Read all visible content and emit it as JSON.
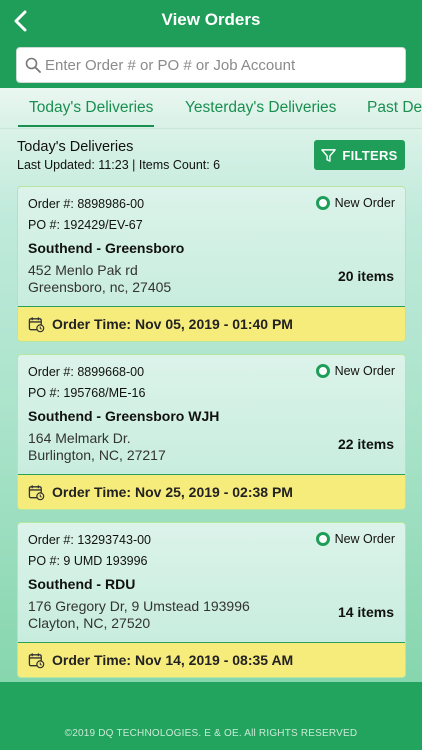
{
  "header": {
    "title": "View Orders",
    "back_icon": "back-arrow-icon"
  },
  "search": {
    "placeholder": "Enter Order # or PO # or Job Account",
    "value": ""
  },
  "tabs": [
    {
      "label": "Today's Deliveries",
      "active": true
    },
    {
      "label": "Yesterday's Deliveries",
      "active": false
    },
    {
      "label": "Past Deliveries",
      "active": false
    }
  ],
  "list": {
    "title": "Today's Deliveries",
    "meta": "Last Updated: 11:23 | Items Count: 6",
    "filters_label": "FILTERS"
  },
  "orders": [
    {
      "order": "Order #: 8898986-00",
      "po": "PO #: 192429/EV-67",
      "name": "Southend - Greensboro",
      "addr1": "452 Menlo Pak rd",
      "addr2": "Greensboro, nc, 27405",
      "items": "20 items",
      "status": "New Order",
      "order_time": "Order Time: Nov 05, 2019 - 01:40 PM"
    },
    {
      "order": "Order #: 8899668-00",
      "po": "PO #: 195768/ME-16",
      "name": "Southend - Greensboro WJH",
      "addr1": "164 Melmark Dr.",
      "addr2": "Burlington, NC, 27217",
      "items": "22 items",
      "status": "New Order",
      "order_time": "Order Time: Nov 25, 2019 - 02:38 PM"
    },
    {
      "order": "Order #: 13293743-00",
      "po": "PO #: 9 UMD 193996",
      "name": "Southend - RDU",
      "addr1": "176 Gregory Dr, 9 Umstead 193996",
      "addr2": "Clayton, NC, 27520",
      "items": "14 items",
      "status": "New Order",
      "order_time": "Order Time: Nov 14, 2019 - 08:35 AM"
    }
  ],
  "footer": {
    "copyright": "©2019 DQ TECHNOLOGIES. E & OE. All RIGHTS RESERVED"
  },
  "colors": {
    "brand_green": "#1e9e58",
    "order_time_bar": "#f6ec7c",
    "card_border": "#b6e7a0"
  }
}
